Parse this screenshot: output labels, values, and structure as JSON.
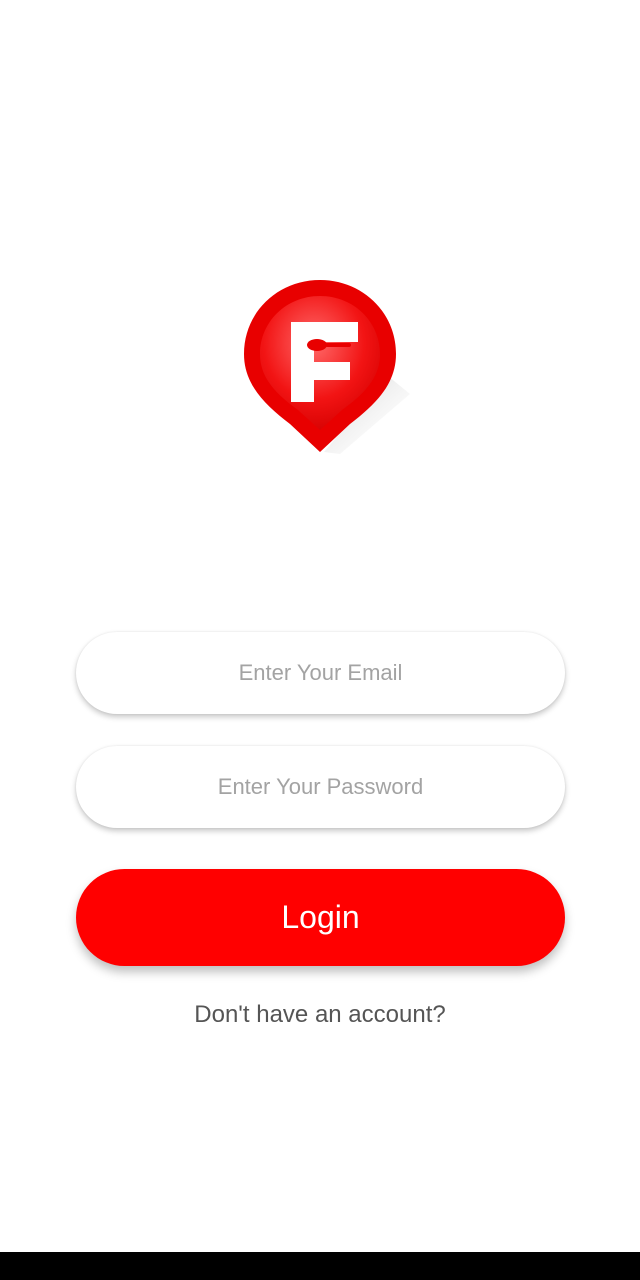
{
  "app": {
    "logo": {
      "letter": "F",
      "icon": "map-pin-fork-icon",
      "brand_color": "#ff0000"
    }
  },
  "login_form": {
    "email_placeholder": "Enter Your Email",
    "email_value": "",
    "password_placeholder": "Enter Your Password",
    "password_value": "",
    "login_label": "Login",
    "login_color": "#ff0000",
    "signup_prompt": "Don't have an account?"
  }
}
